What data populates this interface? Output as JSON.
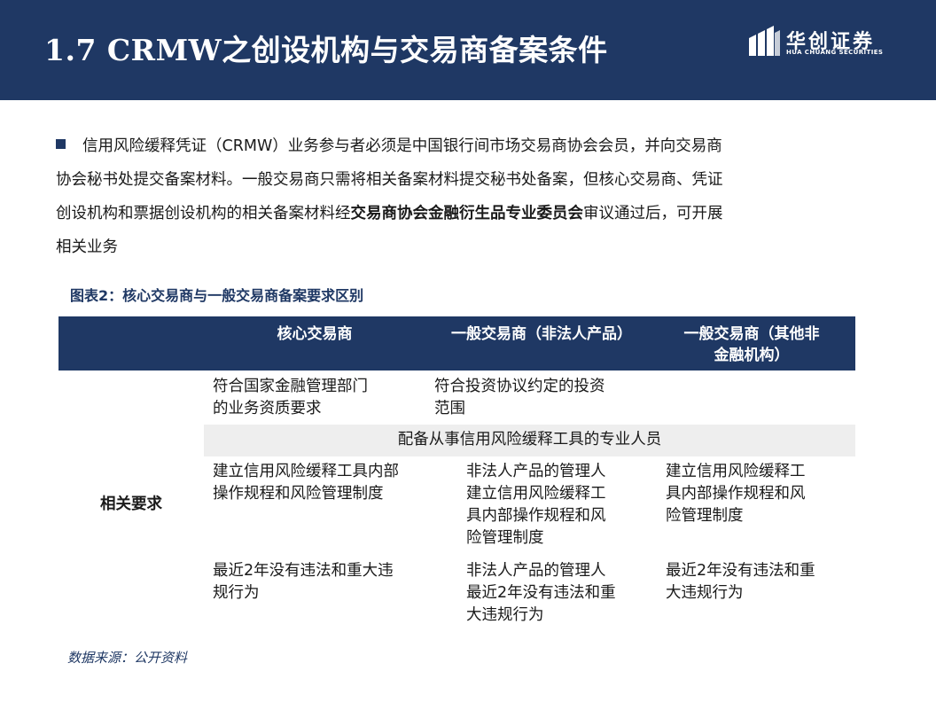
{
  "header": {
    "title": "1.7 CRMW之创设机构与交易商备案条件",
    "logo_cn": "华创证券",
    "logo_en": "HUA CHUANG SECURITIES",
    "logo_icon": "hua-chuang-logo-icon",
    "background_color": "#1f3864"
  },
  "paragraph": {
    "line1": "信用风险缓释凭证（CRMW）业务参与者必须是中国银行间市场交易商协会会员，并向交易商",
    "line2": "协会秘书处提交备案材料。一般交易商只需将相关备案材料提交秘书处备案，但核心交易商、凭证",
    "line3_before": "创设机构和票据创设机构的相关备案材料经",
    "line3_bold": "交易商协会金融衍生品专业委员会",
    "line3_after": "审议通过后，可开展",
    "line4": "相关业务"
  },
  "figure": {
    "title": "图表2：核心交易商与一般交易商备案要求区别"
  },
  "table": {
    "headers": {
      "core": "核心交易商",
      "general_nonlegal": "一般交易商（非法人产品）",
      "general_other_l1": "一般交易商（其他非",
      "general_other_l2": "金融机构）"
    },
    "row_label": "相关要求",
    "r1": {
      "core_l1": "符合国家金融管理部门",
      "core_l2": "的业务资质要求",
      "nonlegal_l1": "符合投资协议约定的投资",
      "nonlegal_l2": "范围"
    },
    "r2": {
      "merged": "配备从事信用风险缓释工具的专业人员"
    },
    "r3": {
      "core_l1": "建立信用风险缓释工具内部",
      "core_l2": "操作规程和风险管理制度",
      "nonlegal_l1": "非法人产品的管理人",
      "nonlegal_l2": "建立信用风险缓释工",
      "nonlegal_l3": "具内部操作规程和风",
      "nonlegal_l4": "险管理制度",
      "other_l1": "建立信用风险缓释工",
      "other_l2": "具内部操作规程和风",
      "other_l3": "险管理制度"
    },
    "r4": {
      "core_l1": "最近2年没有违法和重大违",
      "core_l2": "规行为",
      "nonlegal_l1": "非法人产品的管理人",
      "nonlegal_l2": "最近2年没有违法和重",
      "nonlegal_l3": "大违规行为",
      "other_l1": "最近2年没有违法和重",
      "other_l2": "大违规行为"
    }
  },
  "source": "数据来源：公开资料"
}
